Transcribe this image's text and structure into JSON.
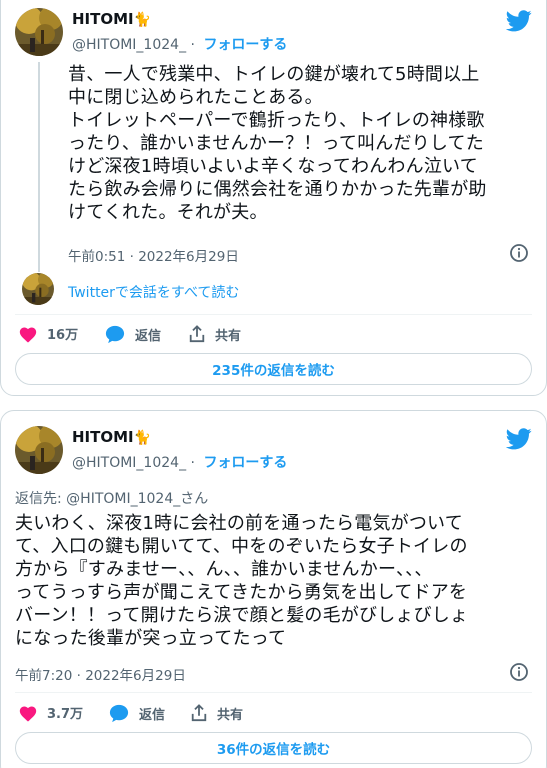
{
  "tweet1": {
    "name": "HITOMI",
    "name_emoji": "🐈",
    "handle": "@HITOMI_1024_",
    "dot": "·",
    "follow_label": "フォローする",
    "text": "昔、一人で残業中、トイレの鍵が壊れて5時間以上\n中に閉じ込められたことある。\nトイレットペーパーで鶴折ったり、トイレの神様歌\nったり、誰かいませんかー？！って叫んだりしてた\nけど深夜1時頃いよいよ辛くなってわんわん泣いて\nたら飲み会帰りに偶然会社を通りかかった先輩が助\nけてくれた。それが夫。",
    "timestamp": "午前0:51 · 2022年6月29日",
    "convo_link": "Twitterで会話をすべて読む",
    "likes": "16万",
    "reply_label": "返信",
    "share_label": "共有",
    "read_replies": "235件の返信を読む"
  },
  "tweet2": {
    "name": "HITOMI",
    "name_emoji": "🐈",
    "handle": "@HITOMI_1024_",
    "dot": "·",
    "follow_label": "フォローする",
    "reply_to": "返信先: @HITOMI_1024_さん",
    "text": "夫いわく、深夜1時に会社の前を通ったら電気がついて\nて、入口の鍵も開いてて、中をのぞいたら女子トイレの\n方から『すみませー、、ん、、誰かいませんかー、、、\nってうっすら声が聞こえてきたから勇気を出してドアを\nバーン！！って開けたら涙で顔と髪の毛がびしょびしょ\nになった後輩が突っ立ってたって",
    "timestamp": "午前7:20 · 2022年6月29日",
    "likes": "3.7万",
    "reply_label": "返信",
    "share_label": "共有",
    "read_replies": "36件の返信を読む"
  },
  "colors": {
    "twitter_blue": "#1d9bf0",
    "like_red": "#f91880",
    "text": "#0f1419",
    "muted": "#536471",
    "border": "#cfd9de"
  },
  "icons": [
    "twitter-bird-icon",
    "info-icon",
    "heart-icon",
    "reply-bubble-icon",
    "share-icon",
    "cat-emoji-icon"
  ]
}
